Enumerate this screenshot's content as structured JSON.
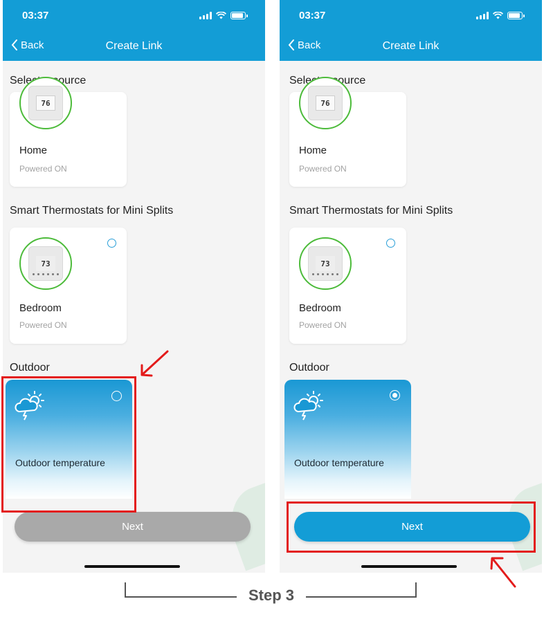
{
  "status": {
    "time": "03:37"
  },
  "nav": {
    "back_label": "Back",
    "title": "Create Link"
  },
  "sections": {
    "source": "Select a source",
    "mini_splits": "Smart Thermostats for Mini Splits",
    "outdoor": "Outdoor"
  },
  "devices": [
    {
      "name": "Home",
      "status": "Powered ON",
      "reading": "76"
    },
    {
      "name": "Bedroom",
      "status": "Powered ON",
      "reading": "73"
    }
  ],
  "outdoor_card": {
    "label": "Outdoor temperature"
  },
  "screens": [
    {
      "outdoor_selected": false,
      "next_enabled": false
    },
    {
      "outdoor_selected": true,
      "next_enabled": true
    }
  ],
  "next_label": "Next",
  "step_label": "Step 3",
  "colors": {
    "header": "#139dd6",
    "ring": "#4cbb3a",
    "next_active": "#139dd6",
    "next_disabled": "#a9a9a9",
    "highlight": "#e31b1b"
  }
}
